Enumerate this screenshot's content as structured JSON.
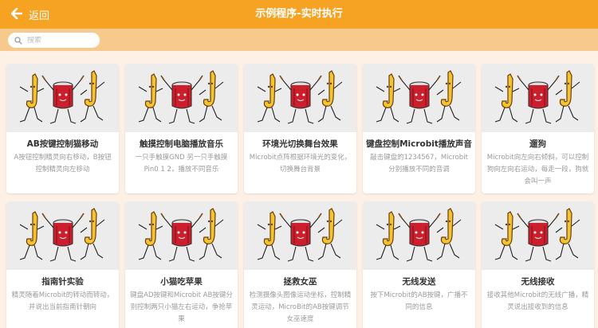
{
  "header": {
    "back_label": "返回",
    "title": "示例程序-实时执行"
  },
  "search": {
    "placeholder": "搜索"
  },
  "colors": {
    "header_bg": "#f6a323",
    "search_bar_bg": "#f8c98c",
    "page_bg": "#fdf1e6",
    "card_image_bg": "#ececec"
  },
  "cards": [
    {
      "title": "AB按键控制猫移动",
      "desc": "A按钮控制精灵向右移动，B按钮控制精灵向左移动"
    },
    {
      "title": "触摸控制电脑播放音乐",
      "desc": "一只手触摸GND 另一只手触摸Pin0 1 2，播放不同音乐"
    },
    {
      "title": "环境光切换舞台效果",
      "desc": "Microbit点阵根据环境光的变化，切换舞台背景"
    },
    {
      "title": "键盘控制Microbit播放声音",
      "desc": "敲击键盘的1234567，Microbit分别播放不同的音调"
    },
    {
      "title": "遛狗",
      "desc": "Microbit向左向右倾斜，可以控制狗向左向右运动，每走一段，狗就会叫一声"
    },
    {
      "title": "指南针实验",
      "desc": "精灵随着Microbit的转动而转动，并说出当前指南针朝向"
    },
    {
      "title": "小猫吃苹果",
      "desc": "键盘AD按键和Microbit AB按键分别控制两只小猫左右运动，争抢苹果"
    },
    {
      "title": "拯救女巫",
      "desc": "检测摄像头图像运动坐标，控制精灵运动，MicroBit的AB按键调节女巫速度"
    },
    {
      "title": "无线发送",
      "desc": "按下Microbit的AB按键，广播不同的信息"
    },
    {
      "title": "无线接收",
      "desc": "接收其他Microbit的无线广播，精灵说出接收到的信息"
    }
  ]
}
